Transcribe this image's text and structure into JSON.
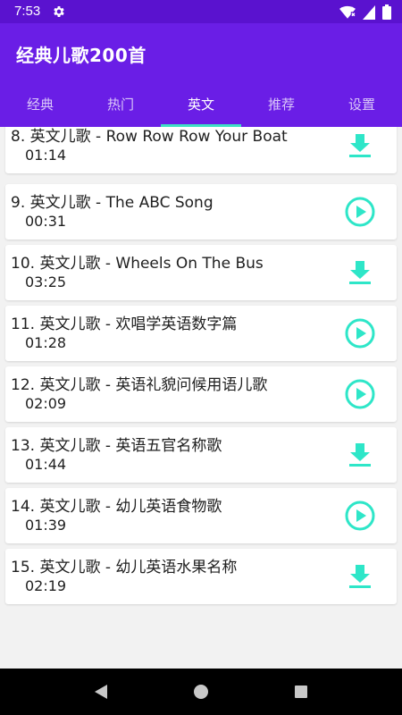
{
  "status_bar": {
    "time": "7:53"
  },
  "app_bar": {
    "title": "经典儿歌200首"
  },
  "tabs": [
    {
      "label": "经典"
    },
    {
      "label": "热门"
    },
    {
      "label": "英文"
    },
    {
      "label": "推荐"
    },
    {
      "label": "设置"
    }
  ],
  "active_tab": "英文",
  "accent_color": "#2ee6c8",
  "songs": [
    {
      "title": "8. 英文儿歌 - Row Row Row Your Boat",
      "duration": "01:14",
      "action_icon": "download-icon"
    },
    {
      "title": "9. 英文儿歌 - The ABC Song",
      "duration": "00:31",
      "action_icon": "play-icon"
    },
    {
      "title": "10. 英文儿歌 - Wheels On The Bus",
      "duration": "03:25",
      "action_icon": "download-icon"
    },
    {
      "title": "11. 英文儿歌 - 欢唱学英语数字篇",
      "duration": "01:28",
      "action_icon": "play-icon"
    },
    {
      "title": "12. 英文儿歌 - 英语礼貌问候用语儿歌",
      "duration": "02:09",
      "action_icon": "play-icon"
    },
    {
      "title": "13. 英文儿歌 - 英语五官名称歌",
      "duration": "01:44",
      "action_icon": "download-icon"
    },
    {
      "title": "14. 英文儿歌 - 幼儿英语食物歌",
      "duration": "01:39",
      "action_icon": "play-icon"
    },
    {
      "title": "15. 英文儿歌 - 幼儿英语水果名称",
      "duration": "02:19",
      "action_icon": "download-icon"
    }
  ]
}
